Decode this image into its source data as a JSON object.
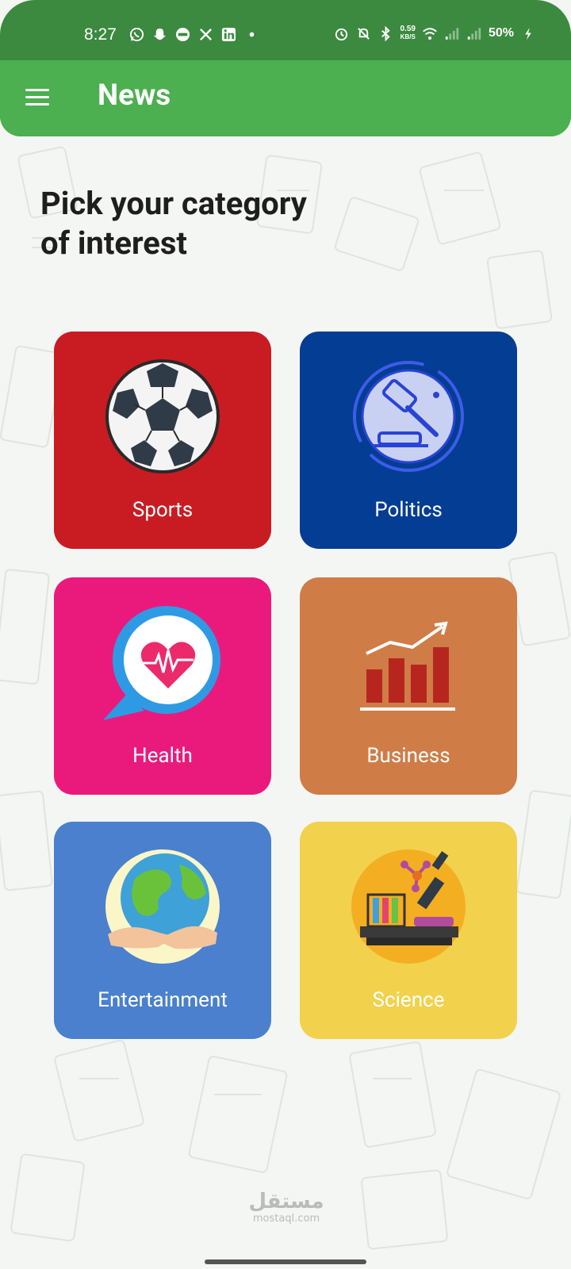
{
  "status_bar": {
    "time": "8:27",
    "left_icons": [
      "whatsapp-icon",
      "snapchat-icon",
      "app-365-icon",
      "x-icon",
      "linkedin-icon",
      "dot-icon"
    ],
    "net_speed_value": "0.59",
    "net_speed_unit": "KB/S",
    "battery": "50%"
  },
  "app_bar": {
    "title": "News"
  },
  "heading": "Pick your category\nof interest",
  "categories": [
    {
      "label": "Sports",
      "color": "#c81c22",
      "icon": "soccer-ball-icon"
    },
    {
      "label": "Politics",
      "color": "#033d94",
      "icon": "gavel-icon"
    },
    {
      "label": "Health",
      "color": "#ea1a7d",
      "icon": "heart-chat-icon"
    },
    {
      "label": "Business",
      "color": "#d07c47",
      "icon": "bar-chart-icon"
    },
    {
      "label": "Entertainment",
      "color": "#4a80cd",
      "icon": "globe-hands-icon"
    },
    {
      "label": "Science",
      "color": "#f2d14c",
      "icon": "microscope-icon"
    }
  ],
  "watermark": {
    "arabic": "مستقل",
    "latin": "mostaql.com"
  },
  "colors": {
    "status_bar": "#3b8a3f",
    "app_bar": "#4caf50",
    "background": "#f4f6f3"
  }
}
